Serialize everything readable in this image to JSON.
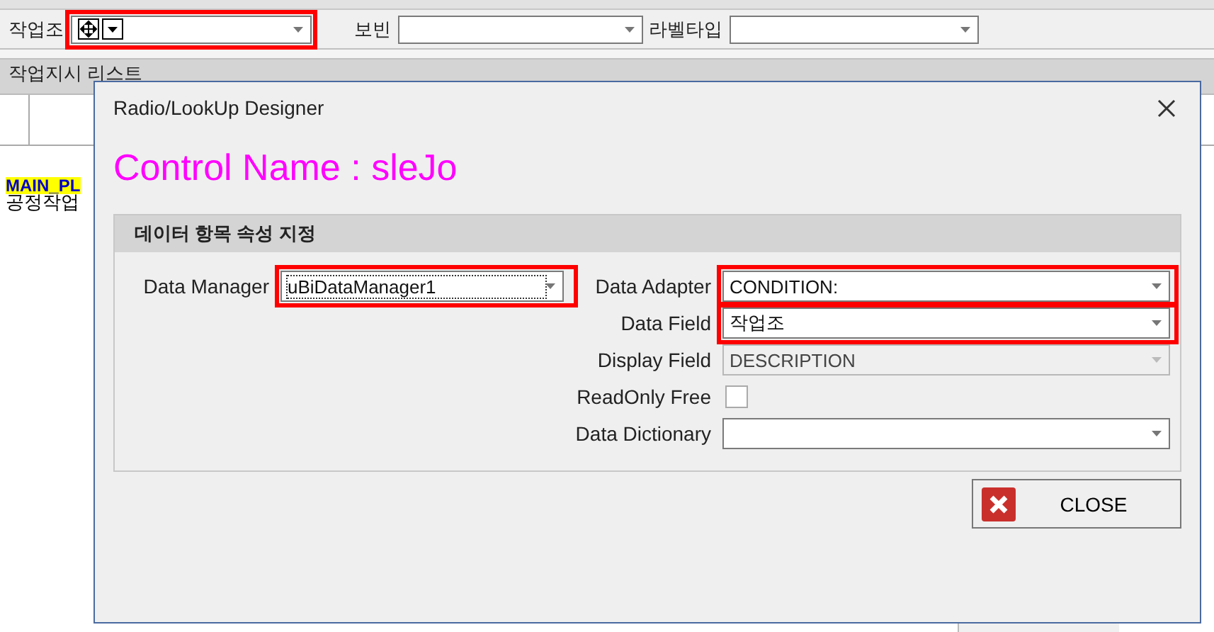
{
  "toolbar": {
    "fields": [
      {
        "label": "작업조",
        "highlighted": true,
        "design_selected": true
      },
      {
        "label": "보빈",
        "highlighted": false,
        "design_selected": false
      },
      {
        "label": "라벨타입",
        "highlighted": false,
        "design_selected": false
      }
    ]
  },
  "panel": {
    "title": "작업지시 리스트",
    "grid_texts": [
      {
        "text": "MAIN_PL",
        "highlighted": true
      },
      {
        "text": "공정작업",
        "highlighted": false
      }
    ]
  },
  "dialog": {
    "title": "Radio/LookUp Designer",
    "control_name": "Control Name : sleJo",
    "group": {
      "title": "데이터 항목 속성 지정",
      "manager": {
        "label": "Data Manager",
        "value": "uBiDataManager1",
        "highlighted": true,
        "focused": true
      },
      "fields": [
        {
          "kind": "combo",
          "label": "Data Adapter",
          "value": "CONDITION:",
          "highlighted": true,
          "disabled": false
        },
        {
          "kind": "combo",
          "label": "Data Field",
          "value": "작업조",
          "highlighted": true,
          "disabled": false
        },
        {
          "kind": "combo",
          "label": "Display Field",
          "value": "DESCRIPTION",
          "highlighted": false,
          "disabled": true
        },
        {
          "kind": "checkbox",
          "label": "ReadOnly Free",
          "checked": false
        },
        {
          "kind": "combo",
          "label": "Data Dictionary",
          "highlighted": false,
          "disabled": false
        }
      ]
    },
    "close_button": "CLOSE"
  }
}
